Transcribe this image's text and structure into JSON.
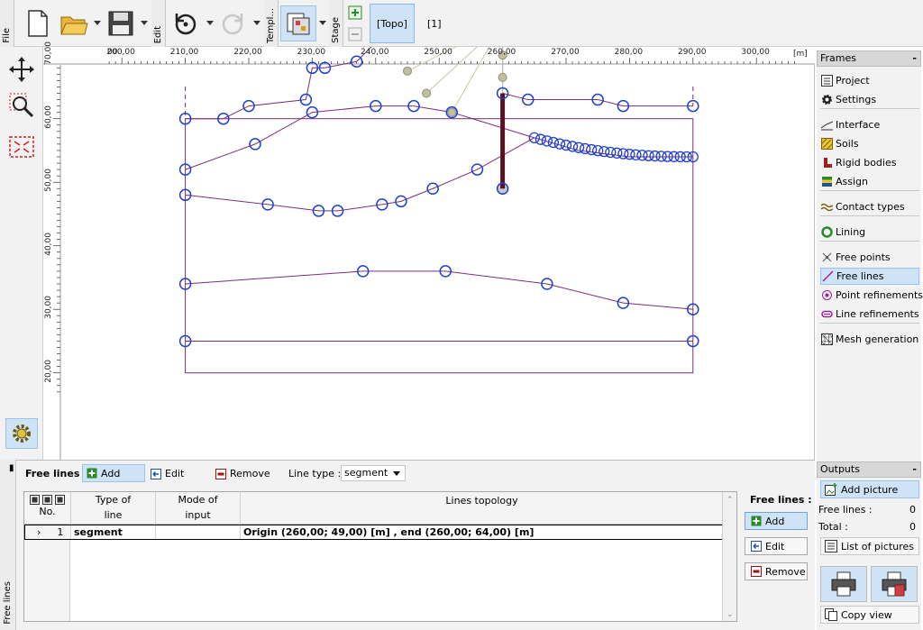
{
  "toolbar": {
    "file_label": "File",
    "edit_label": "Edit",
    "template_label": "Templ...",
    "stage_label": "Stage",
    "stage_tab": "[Topo]",
    "stage_number": "[1]"
  },
  "canvas": {
    "unit": "[m]",
    "x_ticks": [
      "00",
      "200,00",
      "210,00",
      "220,00",
      "230,00",
      "240,00",
      "250,00",
      "260,00",
      "270,00",
      "280,00",
      "290,00",
      "300,00"
    ],
    "y_ticks": [
      "70,00",
      "60,00",
      "50,00",
      "40,00",
      "30,00",
      "20,00"
    ]
  },
  "frames": {
    "title": "Frames",
    "items": [
      {
        "label": "Project",
        "icon": "list-icon"
      },
      {
        "label": "Settings",
        "icon": "gear-icon"
      },
      {
        "label": "Interface",
        "icon": "interface-icon"
      },
      {
        "label": "Soils",
        "icon": "soil-icon"
      },
      {
        "label": "Rigid bodies",
        "icon": "rigid-body-icon"
      },
      {
        "label": "Assign",
        "icon": "assign-icon"
      },
      {
        "label": "Contact types",
        "icon": "contact-icon"
      },
      {
        "label": "Lining",
        "icon": "lining-icon"
      },
      {
        "label": "Free points",
        "icon": "free-points-icon"
      },
      {
        "label": "Free lines",
        "icon": "free-lines-icon"
      },
      {
        "label": "Point refinements",
        "icon": "point-refine-icon"
      },
      {
        "label": "Line refinements",
        "icon": "line-refine-icon"
      },
      {
        "label": "Mesh generation",
        "icon": "mesh-icon"
      }
    ],
    "active": "Free lines"
  },
  "bottom": {
    "side_label": "Free lines",
    "title": "Free lines :",
    "add_label": "Add",
    "edit_label": "Edit",
    "remove_label": "Remove",
    "line_type_label": "Line type :",
    "line_type_value": "segment"
  },
  "table": {
    "headers": {
      "no": "No.",
      "type_a": "Type of",
      "type_b": "line",
      "mode_a": "Mode of",
      "mode_b": "input",
      "topology": "Lines topology"
    },
    "rows": [
      {
        "no": "1",
        "type": "segment",
        "mode": "",
        "topology": "Origin (260,00; 49,00) [m] ,  end (260,00; 64,00) [m]"
      }
    ]
  },
  "side": {
    "title": "Free lines :",
    "add_label": "Add",
    "edit_label": "Edit",
    "remove_label": "Remove"
  },
  "outputs": {
    "title": "Outputs",
    "add_picture": "Add picture",
    "free_lines_label": "Free lines :",
    "free_lines_value": "0",
    "total_label": "Total :",
    "total_value": "0",
    "list_pictures": "List of pictures",
    "copy_view": "Copy view"
  },
  "colors": {
    "point_outline": "#2040d0",
    "polyline": "#7a2e7a",
    "free_line": "#5a1020",
    "active_bg": "#cfe3f7"
  }
}
